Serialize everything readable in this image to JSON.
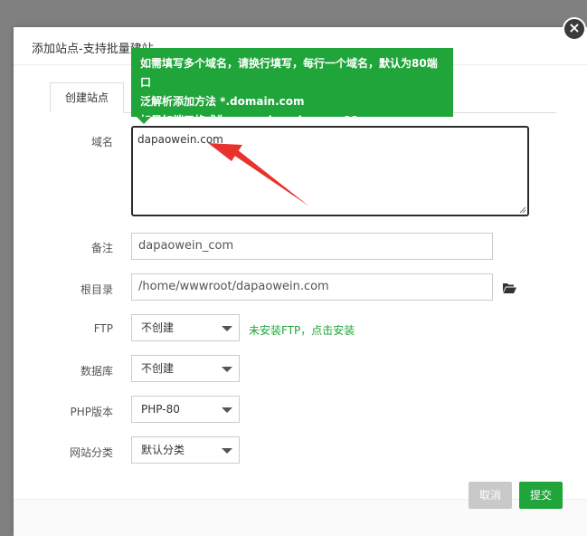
{
  "dialog": {
    "title": "添加站点-支持批量建站",
    "close_label": "×"
  },
  "tabs": [
    {
      "label": "创建站点"
    }
  ],
  "tooltip": {
    "line1": "如需填写多个域名，请换行填写，每行一个域名，默认为80端口",
    "line2": "泛解析添加方法 *.domain.com",
    "line3": "如另加端口格式为 www.domain.com:88"
  },
  "form": {
    "domain": {
      "label": "域名",
      "value": "dapaowein.com"
    },
    "remark": {
      "label": "备注",
      "value": "dapaowein_com"
    },
    "root": {
      "label": "根目录",
      "value": "/home/wwwroot/dapaowein.com",
      "icon": "folder-open-icon"
    },
    "ftp": {
      "label": "FTP",
      "selected": "不创建",
      "hint": "未安装FTP，点击安装"
    },
    "database": {
      "label": "数据库",
      "selected": "不创建"
    },
    "php": {
      "label": "PHP版本",
      "selected": "PHP-80"
    },
    "category": {
      "label": "网站分类",
      "selected": "默认分类"
    }
  },
  "footer": {
    "cancel_label": "取消",
    "submit_label": "提交"
  },
  "colors": {
    "accent": "#20a53a",
    "annotation_arrow": "#e8322d",
    "cancel_bg": "#c9c9c9",
    "overlay": "#808080"
  }
}
